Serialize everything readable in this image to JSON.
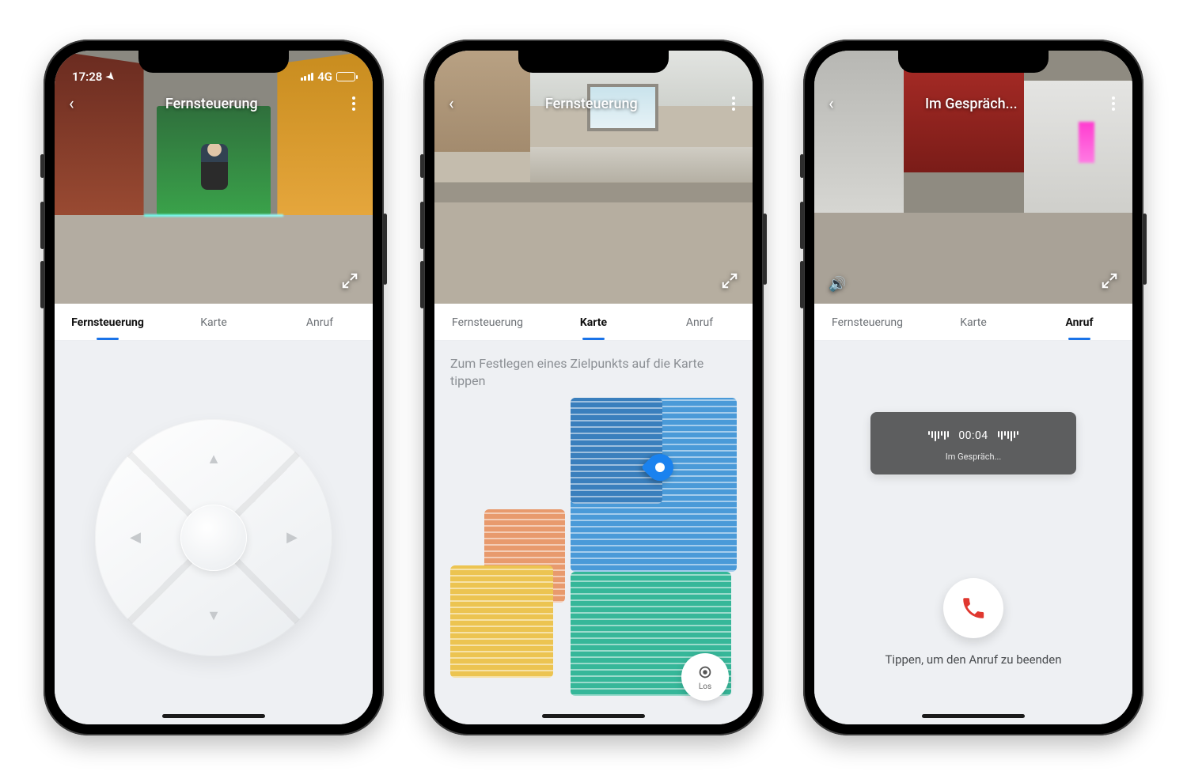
{
  "status_bar": {
    "time": "17:28",
    "network": "4G"
  },
  "tabs": {
    "remote": "Fernsteuerung",
    "map": "Karte",
    "call": "Anruf"
  },
  "phone1": {
    "header_title": "Fernsteuerung",
    "active_tab": "remote"
  },
  "phone2": {
    "header_title": "Fernsteuerung",
    "active_tab": "map",
    "map_hint": "Zum Festlegen eines Zielpunkts auf die Karte tippen",
    "go_label": "Los",
    "map_rooms": [
      {
        "color": "blue",
        "color_hex": "#4a9ad8"
      },
      {
        "color": "blue2",
        "color_hex": "#3a7fbd"
      },
      {
        "color": "orange",
        "color_hex": "#e89a6d"
      },
      {
        "color": "yellow",
        "color_hex": "#ecc451"
      },
      {
        "color": "teal",
        "color_hex": "#36b799"
      }
    ]
  },
  "phone3": {
    "header_title": "Im Gespräch...",
    "active_tab": "call",
    "call_timer": "00:04",
    "call_status": "Im Gespräch...",
    "end_call_hint": "Tippen, um den Anruf zu beenden"
  },
  "icons": {
    "back": "chevron-left-icon",
    "more": "more-vert-icon",
    "expand": "expand-icon",
    "speaker": "speaker-icon",
    "location": "location-icon",
    "target": "target-icon",
    "phone": "phone-icon"
  },
  "colors": {
    "accent": "#1a73e8",
    "danger": "#e0372f",
    "panel_bg": "#eef0f3",
    "card_bg": "#5d5e5f"
  }
}
